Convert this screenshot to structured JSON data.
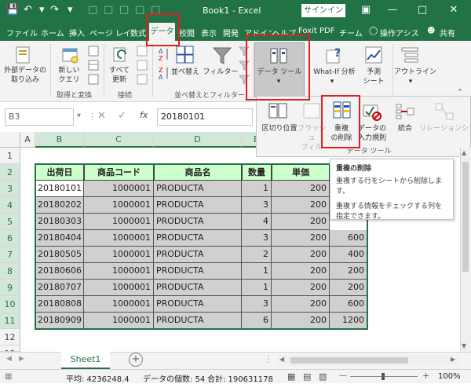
{
  "titlebar": {
    "book_title": "Book1 - Excel",
    "signin": "サインイン"
  },
  "tabs": [
    "ファイル",
    "ホーム",
    "挿入",
    "ページ レイ",
    "数式",
    "データ",
    "校閲",
    "表示",
    "開発",
    "アドイン",
    "ヘルプ",
    "Foxit PDF",
    "チーム"
  ],
  "tell_me": "操作アシス",
  "share": "共有",
  "ribbon": {
    "get_external": "外部データの\n取り込み",
    "new_query": "新しい\nクエリ",
    "refresh_all": "すべて\n更新",
    "group_get_transform": "取得と変換",
    "group_connections": "接続",
    "sort": "並べ替え",
    "filter": "フィルター",
    "group_sort_filter": "並べ替えとフィルター",
    "data_tools": "データ ツール",
    "whatif": "What-If 分析",
    "forecast_sheet": "予測\nシート",
    "outline": "アウトライン",
    "group_forecast": "予測"
  },
  "dropdown": {
    "text_to_columns": "区切り位置",
    "flash_fill": "フラッシュ\nフィル",
    "remove_duplicates": "重複\nの削除",
    "data_validation": "データの\n入力規則",
    "consolidate": "統合",
    "relationships": "リレーションシップ",
    "group_label": "データ ツール"
  },
  "formula_bar": {
    "name_box": "B3",
    "value": "20180101"
  },
  "columns": [
    "A",
    "B",
    "C",
    "D",
    "E",
    "F"
  ],
  "rows": [
    "1",
    "2",
    "3",
    "4",
    "5",
    "6",
    "7",
    "8",
    "9",
    "10",
    "11",
    "12",
    "13"
  ],
  "table": {
    "headers": [
      "出荷日",
      "商品コード",
      "商品名",
      "数量",
      "単価"
    ],
    "rows": [
      {
        "date": "20180101",
        "code": "1000001",
        "name": "PRODUCTA",
        "qty": "1",
        "price": "200",
        "total": ""
      },
      {
        "date": "20180202",
        "code": "1000001",
        "name": "PRODUCTA",
        "qty": "3",
        "price": "200",
        "total": ""
      },
      {
        "date": "20180303",
        "code": "1000001",
        "name": "PRODUCTA",
        "qty": "4",
        "price": "200",
        "total": ""
      },
      {
        "date": "20180404",
        "code": "1000001",
        "name": "PRODUCTA",
        "qty": "3",
        "price": "200",
        "total": "600"
      },
      {
        "date": "20180505",
        "code": "1000001",
        "name": "PRODUCTA",
        "qty": "2",
        "price": "200",
        "total": "400"
      },
      {
        "date": "20180606",
        "code": "1000001",
        "name": "PRODUCTA",
        "qty": "1",
        "price": "200",
        "total": "200"
      },
      {
        "date": "20180707",
        "code": "1000001",
        "name": "PRODUCTA",
        "qty": "1",
        "price": "200",
        "total": "200"
      },
      {
        "date": "20180808",
        "code": "1000001",
        "name": "PRODUCTA",
        "qty": "3",
        "price": "200",
        "total": "600"
      },
      {
        "date": "20180909",
        "code": "1000001",
        "name": "PRODUCTA",
        "qty": "6",
        "price": "200",
        "total": "1200"
      }
    ]
  },
  "tooltip": {
    "title": "重複の削除",
    "line1": "重複する行をシートから削除します。",
    "line2": "重複する情報をチェックする列を指定できます。"
  },
  "sheet_tab": "Sheet1",
  "status": {
    "average": "平均: 4236248.4",
    "count": "データの個数: 54",
    "sum": "合計: 190631178",
    "zoom": "100%"
  },
  "colors": {
    "accent": "#217346",
    "header_fill": "#ccffcc",
    "highlight": "#e0201e"
  }
}
